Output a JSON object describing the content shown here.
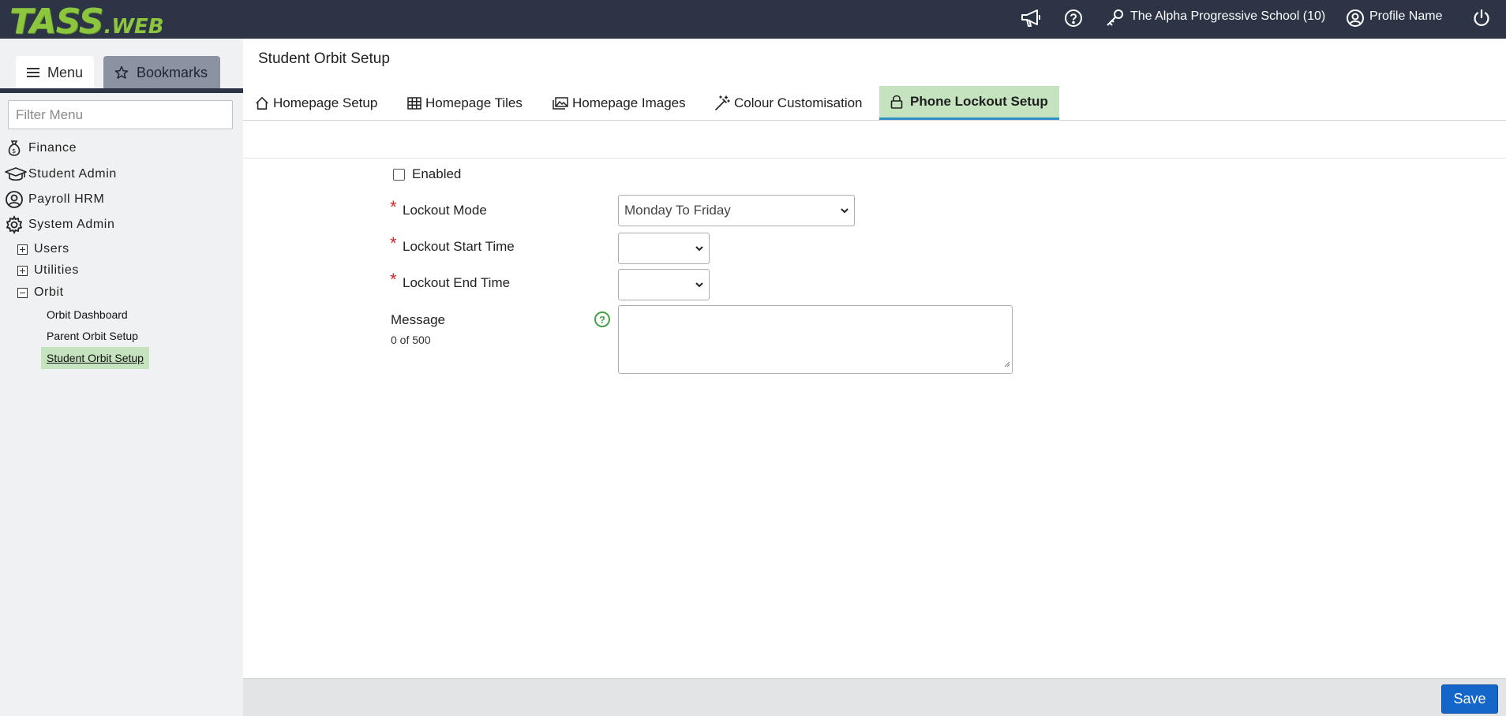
{
  "app": {
    "logo_main": "TASS",
    "logo_sub": ".WEB"
  },
  "header": {
    "school": "The Alpha Progressive School (10)",
    "profile": "Profile Name",
    "icons": [
      "megaphone-icon",
      "help-icon",
      "key-icon",
      "user-icon",
      "power-icon"
    ]
  },
  "sidebar": {
    "menu_tab": "Menu",
    "bookmarks_tab": "Bookmarks",
    "filter_placeholder": "Filter Menu",
    "modules": [
      {
        "label": "Finance",
        "icon": "money-bag-icon"
      },
      {
        "label": "Student Admin",
        "icon": "graduation-cap-icon"
      },
      {
        "label": "Payroll HRM",
        "icon": "user-circle-icon"
      },
      {
        "label": "System Admin",
        "icon": "gear-icon"
      }
    ],
    "tree": [
      {
        "label": "Users",
        "state": "collapsed"
      },
      {
        "label": "Utilities",
        "state": "collapsed"
      },
      {
        "label": "Orbit",
        "state": "expanded"
      }
    ],
    "orbit_children": [
      {
        "label": "Orbit Dashboard",
        "active": false
      },
      {
        "label": "Parent Orbit Setup",
        "active": false
      },
      {
        "label": "Student Orbit Setup",
        "active": true
      }
    ]
  },
  "main": {
    "title": "Student Orbit Setup",
    "tabs": [
      {
        "label": "Homepage Setup",
        "icon": "home-icon"
      },
      {
        "label": "Homepage Tiles",
        "icon": "grid-icon"
      },
      {
        "label": "Homepage Images",
        "icon": "images-icon"
      },
      {
        "label": "Colour Customisation",
        "icon": "magic-wand-icon"
      },
      {
        "label": "Phone Lockout Setup",
        "icon": "lock-icon",
        "active": true
      }
    ]
  },
  "form": {
    "enabled_label": "Enabled",
    "enabled_checked": false,
    "lockout_mode_label": "Lockout Mode",
    "lockout_mode_value": "Monday To Friday",
    "start_time_label": "Lockout Start Time",
    "start_time_value": "",
    "end_time_label": "Lockout End Time",
    "end_time_value": "",
    "message_label": "Message",
    "message_counter": "0 of 500",
    "message_value": "",
    "required_mark": "*",
    "help_glyph": "?"
  },
  "footer": {
    "save_label": "Save"
  },
  "colors": {
    "topbar": "#2c3445",
    "logo": "#8cc63f",
    "active_highlight": "#c6e3bf",
    "primary_button": "#1466c8",
    "required": "#d02a2a",
    "help": "#46a04a"
  }
}
